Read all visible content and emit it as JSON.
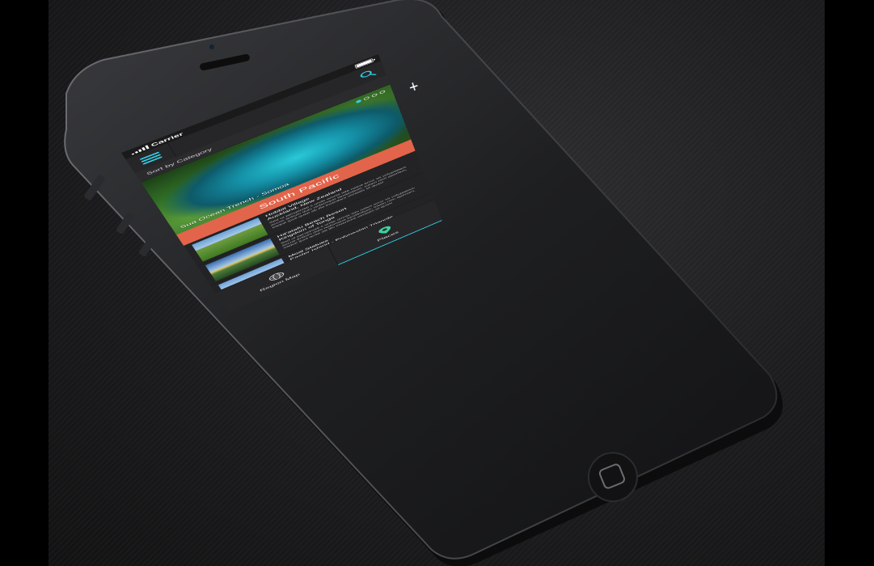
{
  "status_bar": {
    "carrier": "Carrier"
  },
  "app_bar": {
    "menu_icon": "hamburger-icon",
    "search_icon": "search-icon",
    "add_icon": "plus-icon",
    "add_label": "+"
  },
  "sort_bar": {
    "label": "Sort by Category"
  },
  "hero": {
    "caption": "Sua Ocean Trench - Somoa",
    "slides_total": 4,
    "active_slide": 1
  },
  "region_band": {
    "label": "South Pacific"
  },
  "places": [
    {
      "title": "Hobbit Village",
      "subtitle": "Auckland, New Zealand",
      "description": "Sed ut perspiciati s unde omnis iste natus error sit voluptatem accus antium dolo redemque laudantium, totam rem aperiam, eaque ipsa quae ab illo inventore veritatis et quasi"
    },
    {
      "title": "Ha'atafu Beach Resort",
      "subtitle": "Kingdom of Tonga",
      "description": "Sed ut perspiciati s unde omnis iste natus error sit voluptatem accus antium dolo redemque laudantium, totam rem aperiam, eaque ipsa quae ab illo inventore veritatis et quasi"
    },
    {
      "title": "Moai Statues",
      "subtitle": "Easter Island - Polynesian Triangle",
      "description": ""
    }
  ],
  "tab_bar": {
    "tabs": [
      {
        "label": "Region Map",
        "icon": "globe-icon",
        "active": false
      },
      {
        "label": "Places",
        "icon": "map-pin-icon",
        "active": true
      }
    ]
  },
  "colors": {
    "accent": "#2fd0e8",
    "band": "#e2644a",
    "pin": "#3fd2a0",
    "screen_bg": "#232325"
  }
}
